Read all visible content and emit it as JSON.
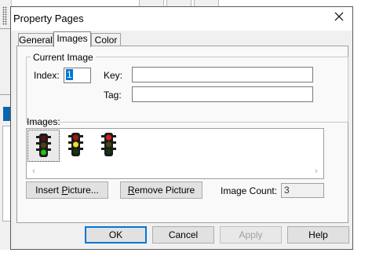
{
  "dialog": {
    "title": "Property Pages"
  },
  "tabs": [
    {
      "label": "General",
      "active": false
    },
    {
      "label": "Images",
      "active": true
    },
    {
      "label": "Color",
      "active": false
    }
  ],
  "current_image": {
    "group_label": "Current Image",
    "index_label": "Index:",
    "index_value": "1",
    "key_label": "Key:",
    "key_value": "",
    "tag_label": "Tag:",
    "tag_value": ""
  },
  "images": {
    "label": "Images:",
    "thumbnails": [
      {
        "name": "traffic-light-green-icon",
        "lit": "green",
        "selected": true
      },
      {
        "name": "traffic-light-yellow-icon",
        "lit": "yellow",
        "selected": false
      },
      {
        "name": "traffic-light-red-icon",
        "lit": "red",
        "selected": false
      }
    ]
  },
  "actions": {
    "insert_prefix": "Insert ",
    "insert_hot": "P",
    "insert_suffix": "icture...",
    "remove_hot": "R",
    "remove_suffix": "emove Picture",
    "image_count_label": "Image Count:",
    "image_count_value": "3"
  },
  "footer": {
    "ok": "OK",
    "cancel": "Cancel",
    "apply": "Apply",
    "help": "Help"
  },
  "colors": {
    "selection": "#0078d7",
    "light_green": "#22c21a",
    "light_yellow": "#f2e11a",
    "light_red": "#e21a1a",
    "light_off": "#5a1010"
  }
}
